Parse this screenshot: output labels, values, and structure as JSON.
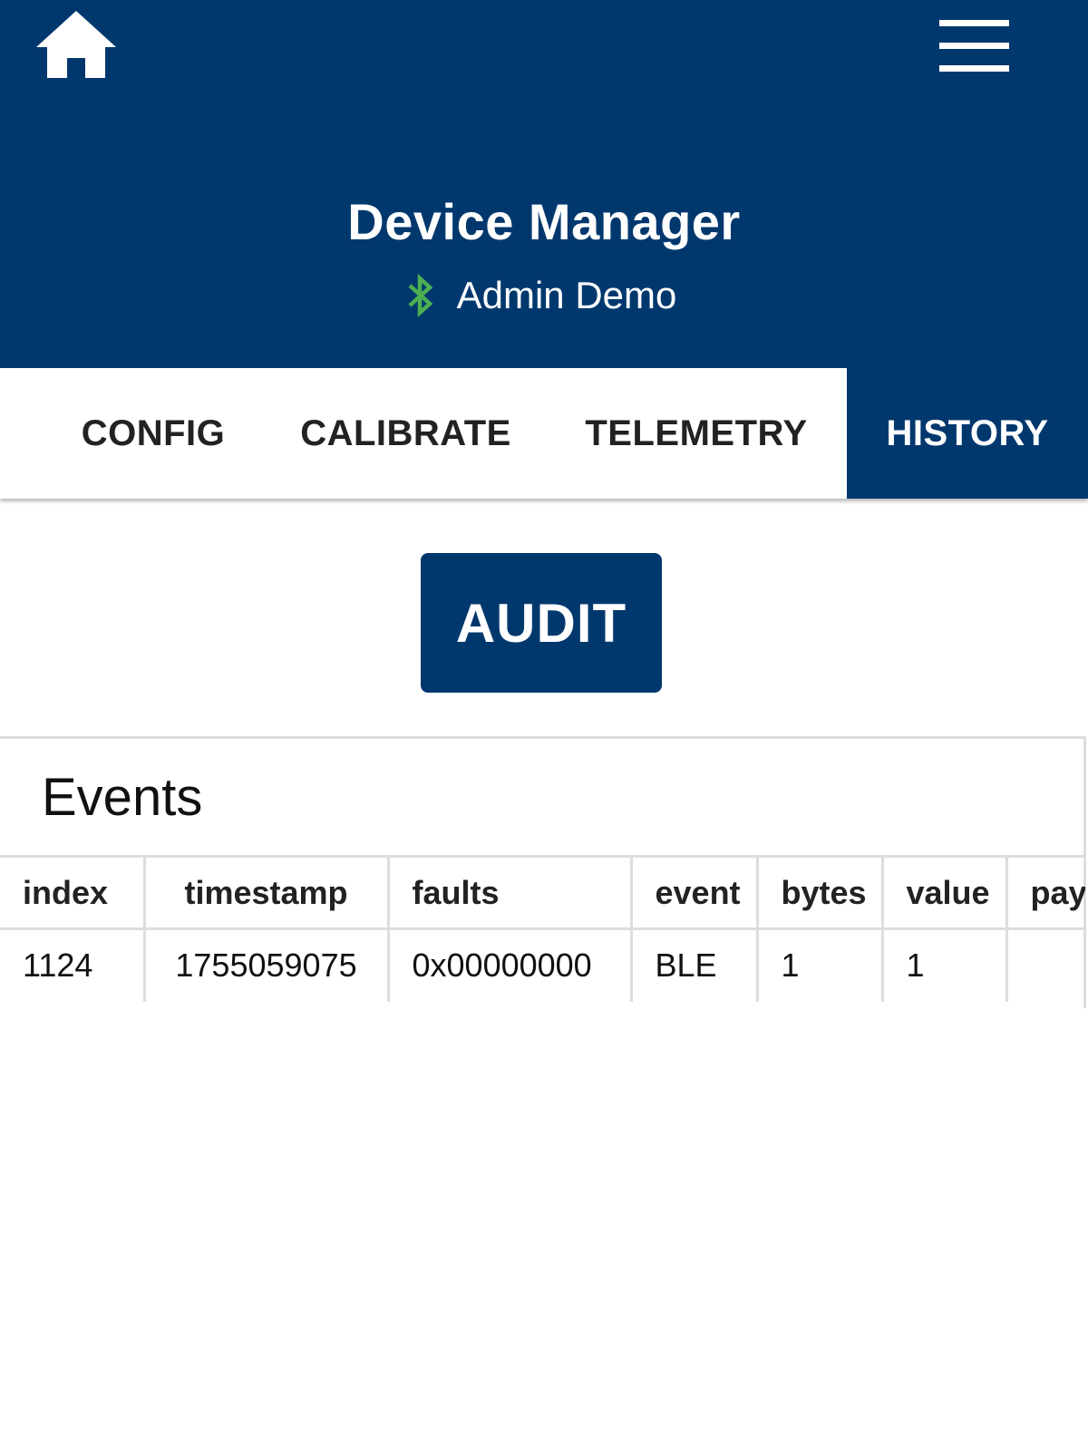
{
  "header": {
    "title": "Device Manager",
    "device_name": "Admin Demo",
    "bluetooth_color": "#4caf50",
    "background_color": "#00386e"
  },
  "tabs": [
    {
      "label": "CONFIG",
      "active": false
    },
    {
      "label": "CALIBRATE",
      "active": false
    },
    {
      "label": "TELEMETRY",
      "active": false
    },
    {
      "label": "HISTORY",
      "active": true
    }
  ],
  "audit_button": {
    "label": "AUDIT"
  },
  "events": {
    "title": "Events",
    "columns": [
      "index",
      "timestamp",
      "faults",
      "event",
      "bytes",
      "value",
      "payl"
    ],
    "rows": [
      [
        "1124",
        "1755059075",
        "0x00000000",
        "BLE",
        "1",
        "1",
        ""
      ]
    ]
  },
  "icons": {
    "home": "home-icon",
    "menu": "hamburger-menu-icon",
    "bluetooth": "bluetooth-icon"
  }
}
